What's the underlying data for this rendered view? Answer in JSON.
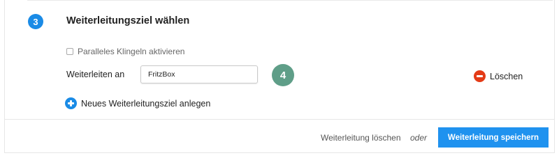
{
  "section": {
    "step_number": "3",
    "title": "Weiterleitungsziel wählen"
  },
  "parallel_ringing": {
    "label": "Paralleles Klingeln aktivieren",
    "checked": false
  },
  "forward_target": {
    "label": "Weiterleiten an",
    "value": "FritzBox",
    "annotation_number": "4",
    "delete_label": "Löschen"
  },
  "add_target": {
    "label": "Neues Weiterleitungsziel anlegen"
  },
  "footer": {
    "delete_link": "Weiterleitung löschen",
    "or_text": "oder",
    "save_button": "Weiterleitung speichern"
  },
  "colors": {
    "primary_blue": "#1a8be6",
    "delete_red": "#e43b17",
    "annotation_green": "#5f9e88"
  },
  "icons": {
    "delete": "minus-circle-icon",
    "add": "plus-circle-icon"
  }
}
